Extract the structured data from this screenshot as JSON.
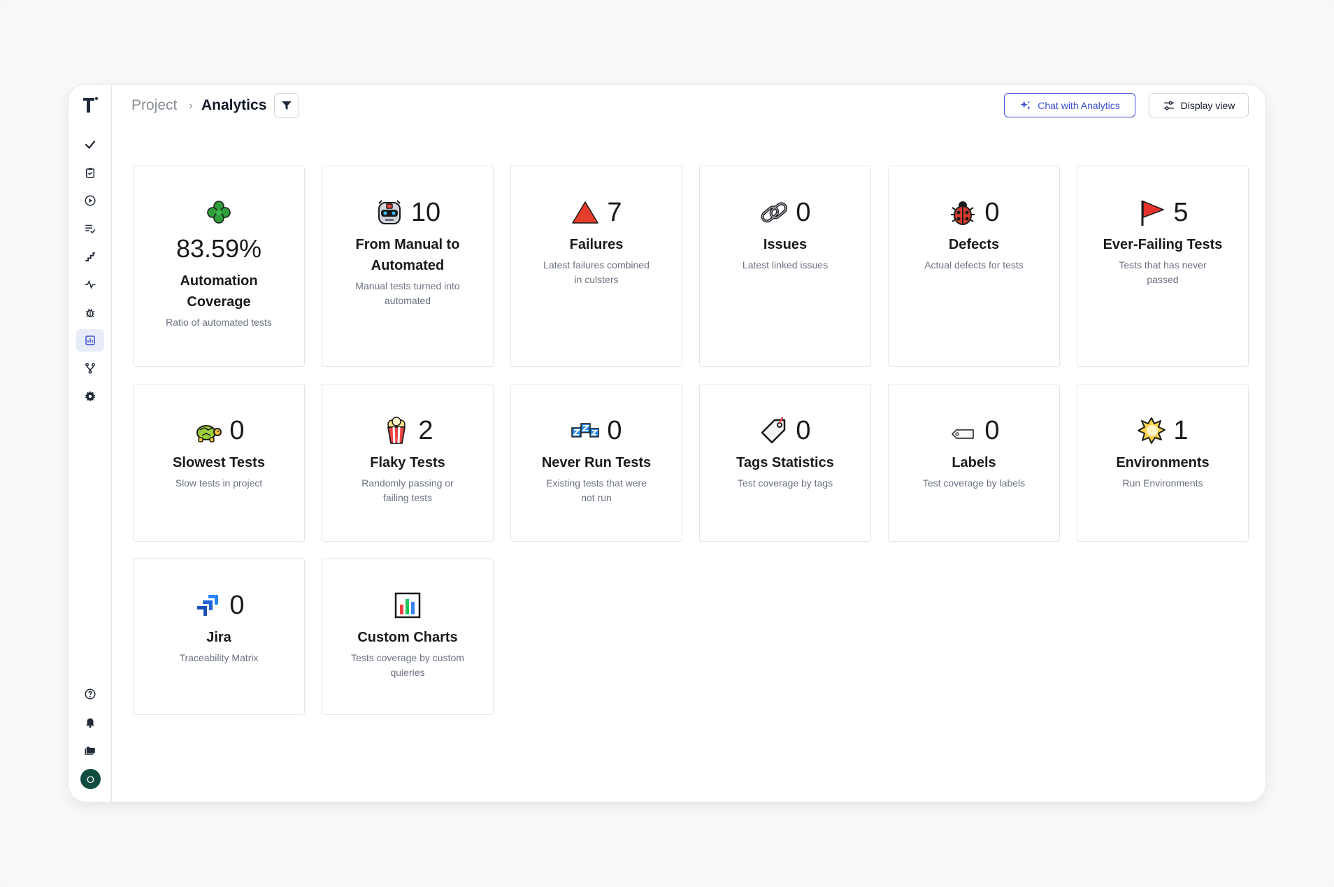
{
  "breadcrumb": {
    "project": "Project",
    "separator": "›",
    "current": "Analytics"
  },
  "header": {
    "chat_label": "Chat with Analytics",
    "display_label": "Display view",
    "accent_color": "#3b4fd0"
  },
  "sidebar": {
    "items": [
      {
        "icon": "check-icon"
      },
      {
        "icon": "clipboard-check-icon"
      },
      {
        "icon": "play-circle-icon"
      },
      {
        "icon": "list-check-icon"
      },
      {
        "icon": "steps-icon"
      },
      {
        "icon": "pulse-icon"
      },
      {
        "icon": "bug-icon"
      },
      {
        "icon": "analytics-icon",
        "active": true
      },
      {
        "icon": "branch-icon"
      },
      {
        "icon": "gear-icon"
      }
    ],
    "bottom": [
      {
        "icon": "help-icon"
      },
      {
        "icon": "bell-icon"
      },
      {
        "icon": "folders-icon"
      }
    ],
    "avatar_initial": "O"
  },
  "cards": [
    {
      "icon": "clover-icon",
      "value": "83.59%",
      "title": "Automation Coverage",
      "desc": "Ratio of automated tests"
    },
    {
      "icon": "robot-icon",
      "value": "10",
      "title": "From Manual to Automated",
      "desc": "Manual tests turned into automated"
    },
    {
      "icon": "triangle-icon",
      "value": "7",
      "title": "Failures",
      "desc": "Latest failures combined in culsters"
    },
    {
      "icon": "link-icon",
      "value": "0",
      "title": "Issues",
      "desc": "Latest linked issues"
    },
    {
      "icon": "ladybug-icon",
      "value": "0",
      "title": "Defects",
      "desc": "Actual defects for tests"
    },
    {
      "icon": "red-flag-icon",
      "value": "5",
      "title": "Ever-Failing Tests",
      "desc": "Tests that has never passed"
    },
    {
      "icon": "turtle-icon",
      "value": "0",
      "title": "Slowest Tests",
      "desc": "Slow tests in project"
    },
    {
      "icon": "popcorn-icon",
      "value": "2",
      "title": "Flaky Tests",
      "desc": "Randomly passing or failing tests"
    },
    {
      "icon": "zzz-icon",
      "value": "0",
      "title": "Never Run Tests",
      "desc": "Existing tests that were not run"
    },
    {
      "icon": "tag-icon",
      "value": "0",
      "title": "Tags Statistics",
      "desc": "Test coverage by tags"
    },
    {
      "icon": "label-icon",
      "value": "0",
      "title": "Labels",
      "desc": "Test coverage by labels"
    },
    {
      "icon": "burst-icon",
      "value": "1",
      "title": "Environments",
      "desc": "Run Environments"
    },
    {
      "icon": "jira-icon",
      "value": "0",
      "title": "Jira",
      "desc": "Traceability Matrix"
    },
    {
      "icon": "bar-chart-icon",
      "value": "",
      "title": "Custom Charts",
      "desc": "Tests coverage by custom quieries"
    }
  ]
}
